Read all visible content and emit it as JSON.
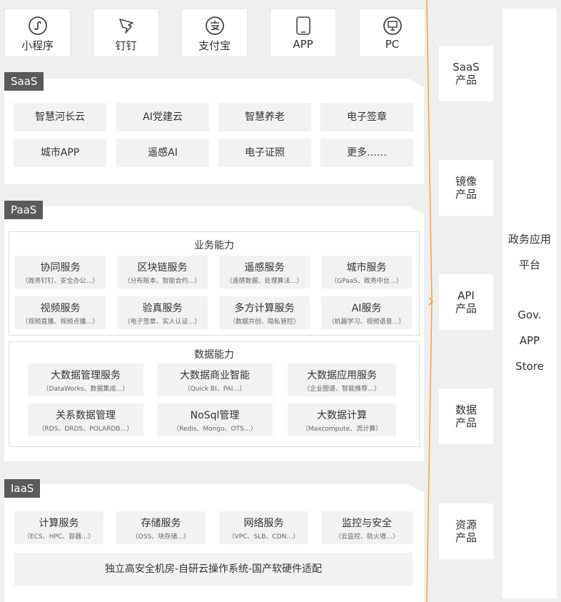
{
  "endpoints": [
    {
      "label": "小程序",
      "icon": "mini-program-icon"
    },
    {
      "label": "钉钉",
      "icon": "dingtalk-icon"
    },
    {
      "label": "支付宝",
      "icon": "alipay-icon"
    },
    {
      "label": "APP",
      "icon": "app-icon"
    },
    {
      "label": "PC",
      "icon": "pc-monitor-icon"
    }
  ],
  "saas": {
    "tag": "SaaS",
    "items": [
      "智慧河长云",
      "AI党建云",
      "智慧养老",
      "电子签章",
      "城市APP",
      "遥感AI",
      "电子证照",
      "更多……"
    ]
  },
  "paas": {
    "tag": "PaaS",
    "business": {
      "title": "业务能力",
      "items": [
        {
          "t": "协同服务",
          "s": "（政务钉钉、安全办公…）"
        },
        {
          "t": "区块链服务",
          "s": "（分布账本、智能合约…）"
        },
        {
          "t": "遥感服务",
          "s": "（遥感数据、处理算法…）"
        },
        {
          "t": "城市服务",
          "s": "（GPaaS、政务中台…）"
        },
        {
          "t": "视频服务",
          "s": "（视频直播、视频点播…）"
        },
        {
          "t": "验真服务",
          "s": "（电子签章、实人认证…）"
        },
        {
          "t": "多方计算服务",
          "s": "（数据共创、隐私管控）"
        },
        {
          "t": "AI服务",
          "s": "（机器学习、视频语音…）"
        }
      ]
    },
    "data": {
      "title": "数据能力",
      "items": [
        {
          "t": "大数据管理服务",
          "s": "（DataWorks、数据集成…）"
        },
        {
          "t": "大数据商业智能",
          "s": "（Quick BI、PAI…）"
        },
        {
          "t": "大数据应用服务",
          "s": "（企业图谱、智能推荐…）"
        },
        {
          "t": "关系数据管理",
          "s": "（RDS、DRDS、POLARDB…）"
        },
        {
          "t": "NoSql管理",
          "s": "（Redis、Mongo、OTS…）"
        },
        {
          "t": "大数据计算",
          "s": "（Maxcompute、流计算）"
        }
      ]
    }
  },
  "iaas": {
    "tag": "IaaS",
    "items": [
      {
        "t": "计算服务",
        "s": "（ECS、HPC、容器…）"
      },
      {
        "t": "存储服务",
        "s": "（OSS、块存储…）"
      },
      {
        "t": "网络服务",
        "s": "（VPC、SLB、CDN…）"
      },
      {
        "t": "监控与安全",
        "s": "（云监控、防火墙…）"
      }
    ],
    "footer": "独立高安全机房-自研云操作系统-国产软硬件适配"
  },
  "products": [
    {
      "l1": "SaaS",
      "l2": "产品"
    },
    {
      "l1": "镜像",
      "l2": "产品"
    },
    {
      "l1": "API",
      "l2": "产品"
    },
    {
      "l1": "数据",
      "l2": "产品"
    },
    {
      "l1": "资源",
      "l2": "产品"
    }
  ],
  "platform": {
    "line1": "政务应用",
    "line2": "平台",
    "line3": "Gov.",
    "line4": "APP",
    "line5": "Store"
  },
  "colors": {
    "accent": "#f5a040",
    "tag_bg": "#5a5a5a",
    "cell_bg": "#f2f2f2"
  }
}
